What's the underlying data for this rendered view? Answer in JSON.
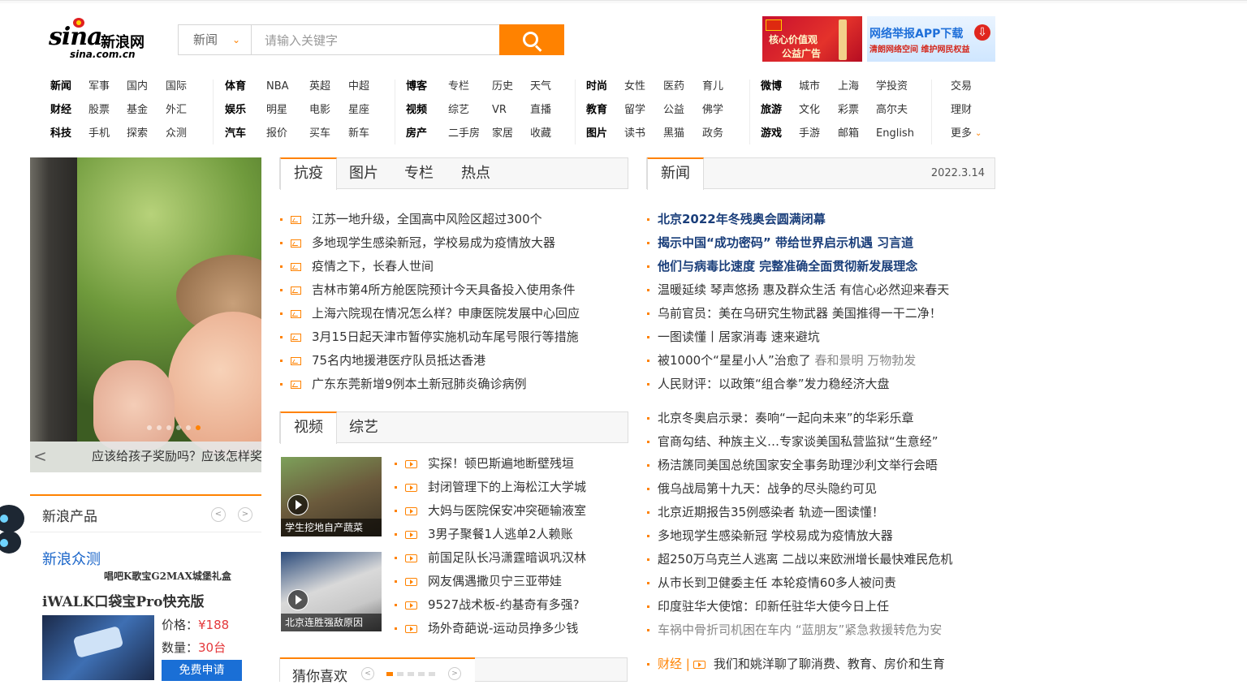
{
  "logo": {
    "text": "sina",
    "cn": "新浪网",
    "domain": "sina.com.cn"
  },
  "search": {
    "category": "新闻",
    "placeholder": "请输入关键字"
  },
  "ads": [
    {
      "line1": "核心价值观",
      "line2": "公益广告"
    },
    {
      "line1": "网络举报APP下载",
      "line2": "清朗网络空间  维护网民权益"
    }
  ],
  "nav": [
    {
      "rows": [
        [
          "新闻",
          "军事",
          "国内",
          "国际"
        ],
        [
          "财经",
          "股票",
          "基金",
          "外汇"
        ],
        [
          "科技",
          "手机",
          "探索",
          "众测"
        ]
      ]
    },
    {
      "rows": [
        [
          "体育",
          "NBA",
          "英超",
          "中超"
        ],
        [
          "娱乐",
          "明星",
          "电影",
          "星座"
        ],
        [
          "汽车",
          "报价",
          "买车",
          "新车"
        ]
      ]
    },
    {
      "rows": [
        [
          "博客",
          "专栏",
          "历史",
          "天气"
        ],
        [
          "视频",
          "综艺",
          "VR",
          "直播"
        ],
        [
          "房产",
          "二手房",
          "家居",
          "收藏"
        ]
      ]
    },
    {
      "rows": [
        [
          "时尚",
          "女性",
          "医药",
          "育儿"
        ],
        [
          "教育",
          "留学",
          "公益",
          "佛学"
        ],
        [
          "图片",
          "读书",
          "黑猫",
          "政务"
        ]
      ]
    },
    {
      "rows": [
        [
          "微博",
          "城市",
          "上海",
          "学投资"
        ],
        [
          "旅游",
          "文化",
          "彩票",
          "高尔夫"
        ],
        [
          "游戏",
          "手游",
          "邮箱",
          "English"
        ]
      ]
    },
    {
      "rows": [
        [
          "交易"
        ],
        [
          "理财"
        ],
        [
          "更多"
        ]
      ]
    }
  ],
  "slideshow": {
    "caption": "应该给孩子奖励吗？应该怎样奖励孩子",
    "prev_label": "<"
  },
  "products": {
    "title": "新浪产品",
    "brand": "新浪众测",
    "subtitle": "唱吧K歌宝G2MAX城堡礼盒",
    "product_name": "iWALK口袋宝Pro快充版",
    "price_label": "价格：",
    "price": "¥188",
    "qty_label": "数量：",
    "qty": "30台",
    "apply_label": "免费申请"
  },
  "tabs_main": [
    "抗疫",
    "图片",
    "专栏",
    "热点"
  ],
  "news_main": [
    "江苏一地升级，全国高中风险区超过300个",
    "多地现学生感染新冠，学校易成为疫情放大器",
    "疫情之下，长春人世间",
    "吉林市第4所方舱医院预计今天具备投入使用条件",
    "上海六院现在情况怎么样？申康医院发展中心回应",
    "3月15日起天津市暂停实施机动车尾号限行等措施",
    "75名内地援港医疗队员抵达香港",
    "广东东莞新增9例本土新冠肺炎确诊病例"
  ],
  "tabs_video": [
    "视频",
    "综艺"
  ],
  "videos": [
    {
      "caption": "学生挖地自产蔬菜"
    },
    {
      "caption": "北京连胜强敌原因"
    }
  ],
  "news_video": [
    "实探！顿巴斯遍地断壁残垣",
    "封闭管理下的上海松江大学城",
    "大妈与医院保安冲突砸输液室",
    "3男子聚餐1人逃单2人赖账",
    "前国足队长冯潇霆暗讽巩汉林",
    "网友偶遇撒贝宁三亚带娃",
    "9527战术板-约基奇有多强?",
    "场外奇葩说-运动员挣多少钱"
  ],
  "guess": {
    "title": "猜你喜欢"
  },
  "news_right": {
    "tab": "新闻",
    "date": "2022.3.14",
    "headlines": [
      "北京2022年冬残奥会圆满闭幕",
      "揭示中国“成功密码” 带给世界启示机遇 习言道",
      "他们与病毒比速度 完整准确全面贯彻新发展理念"
    ],
    "items_a": [
      {
        "text": "温暖延续 琴声悠扬 惠及群众生活 有信心必然迎来春天"
      },
      {
        "text": "乌前官员：美在乌研究生物武器 美国推得一干二净！"
      },
      {
        "text": "一图读懂丨居家消毒 速来避坑"
      },
      {
        "text": "被1000个“星星小人”治愈了 ",
        "tail": "春和景明 万物勃发"
      },
      {
        "text": "人民财评：以政策“组合拳”发力稳经济大盘"
      }
    ],
    "items_b": [
      "北京冬奥启示录：奏响“一起向未来”的华彩乐章",
      "官商勾结、种族主义…专家谈美国私营监狱“生意经”",
      "杨洁篪同美国总统国家安全事务助理沙利文举行会晤",
      "俄乌战局第十九天：战争的尽头隐约可见",
      "北京近期报告35例感染者 轨迹一图读懂！",
      "多地现学生感染新冠 学校易成为疫情放大器",
      "超250万乌克兰人逃离 二战以来欧洲增长最快难民危机",
      "从市长到卫健委主任 本轮疫情60多人被问责",
      "印度驻华大使馆：印新任驻华大使今日上任",
      "车祸中骨折司机困在车内 “蓝朋友”紧急救援转危为安"
    ],
    "finance": {
      "tag": "财经 |",
      "text": "我们和姚洋聊了聊消费、教育、房价和生育"
    }
  },
  "colors": {
    "accent": "#ff8200",
    "link_blue": "#1a3e7a",
    "brand_blue": "#1a65c9"
  }
}
